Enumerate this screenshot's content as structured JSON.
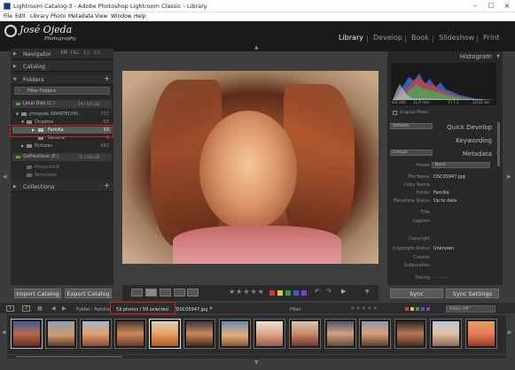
{
  "window": {
    "title": "Lightroom Catalog-3 - Adobe Photoshop Lightroom Classic - Library",
    "min_icon": "minimize-icon",
    "max_icon": "maximize-icon",
    "close_icon": "close-icon"
  },
  "menu": [
    "File",
    "Edit",
    "Library",
    "Photo",
    "Metadata",
    "View",
    "Window",
    "Help"
  ],
  "identity": {
    "logo_text": "José Ojeda",
    "logo_sub": "Photography"
  },
  "modules": [
    "Library",
    "Develop",
    "Book",
    "Slideshow",
    "Print"
  ],
  "navigator": {
    "title": "Navigator",
    "zoom_opts": [
      "FIT",
      "FILL",
      "1:1",
      "2:1"
    ]
  },
  "catalog": {
    "title": "Catalog"
  },
  "folders": {
    "title": "Folders",
    "filter_placeholder": "Filter Folders",
    "vol1": {
      "name": "Local Disk (C:)",
      "space": "19 / 931 GB"
    },
    "rows": [
      {
        "name": "jrmojeda.SMARTECHN...",
        "count": "757"
      },
      {
        "name": "Dropbox",
        "count": "65"
      },
      {
        "name": "Familia",
        "count": "59"
      },
      {
        "name": "General",
        "count": "6"
      },
      {
        "name": "Pictures",
        "count": "692"
      }
    ],
    "vol2": {
      "name": "GoPlexDesk (E:)",
      "space": "75 / 932 GB"
    },
    "rows2": [
      {
        "name": "ProyectoLR",
        "count": ""
      },
      {
        "name": "Templates",
        "count": ""
      }
    ]
  },
  "collections": {
    "title": "Collections"
  },
  "left_buttons": {
    "import": "Import Catalog",
    "export": "Export Catalog"
  },
  "histogram": {
    "title": "Histogram",
    "iso": "ISO 200",
    "focal": "11.0 mm",
    "fstop": "f / 7.1",
    "shutter": "1/125 sec",
    "original": "Original Photo"
  },
  "quick_develop": {
    "title": "Quick Develop",
    "preset": "Defaults"
  },
  "keywording": {
    "title": "Keywording"
  },
  "metadata": {
    "title": "Metadata",
    "preset_dd": "Default",
    "preset_label": "Preset",
    "preset_value": "None",
    "fields": [
      {
        "k": "File Name",
        "v": "DSC05947.jpg"
      },
      {
        "k": "Copy Name",
        "v": ""
      },
      {
        "k": "Folder",
        "v": "Familia"
      },
      {
        "k": "Metadata Status",
        "v": "Up to date"
      },
      {
        "k": "Title",
        "v": ""
      },
      {
        "k": "Caption",
        "v": ""
      },
      {
        "k": "Copyright",
        "v": ""
      },
      {
        "k": "Copyright Status",
        "v": "Unknown"
      },
      {
        "k": "Creator",
        "v": ""
      },
      {
        "k": "Sublocation",
        "v": ""
      },
      {
        "k": "Rating",
        "v": "· · · · ·"
      }
    ]
  },
  "right_buttons": {
    "sync": "Sync",
    "sync_settings": "Sync Settings"
  },
  "filmbar": {
    "page1": "1",
    "page2": "2",
    "path": "Folder : Familia",
    "selection": "59 photos / 59 selected",
    "filename": "/DSC05947.jpg",
    "filter_label": "Filter :",
    "filters_off": "Filters Off"
  },
  "accent": "#e01a1a",
  "color_labels": [
    "#d23a3a",
    "#d8c93a",
    "#3a9a3a",
    "#3a5fc9",
    "#8a3ac9"
  ]
}
